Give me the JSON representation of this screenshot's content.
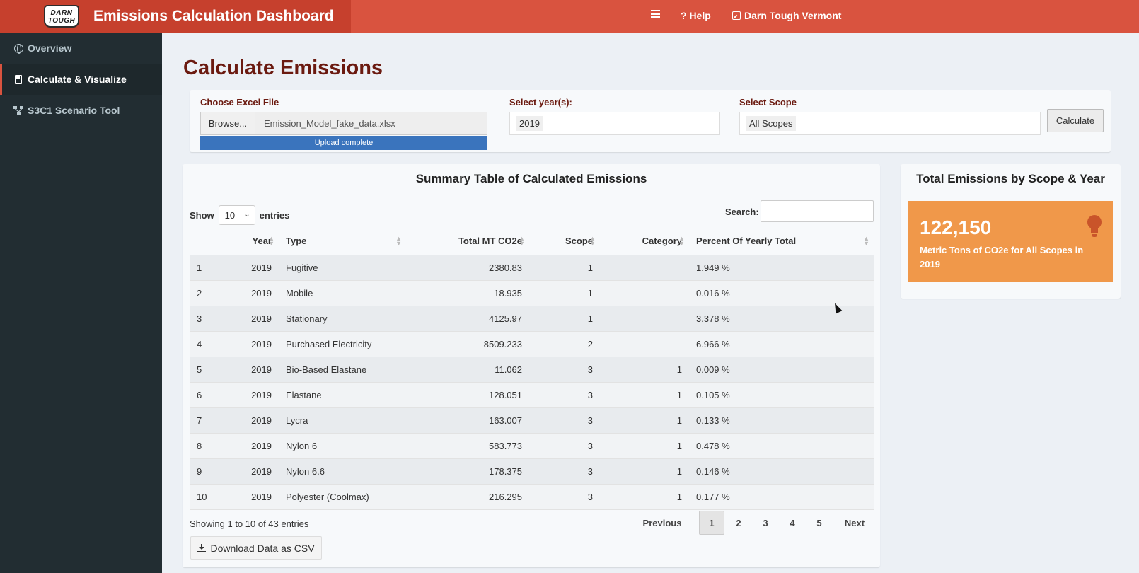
{
  "header": {
    "logo_line1": "DARN",
    "logo_line2": "TOUGH",
    "title": "Emissions Calculation Dashboard",
    "help_label": "? Help",
    "user_label": "Darn Tough Vermont",
    "color": "#d9533f"
  },
  "sidebar": {
    "items": [
      {
        "label": "Overview",
        "icon": "globe-icon"
      },
      {
        "label": "Calculate & Visualize",
        "icon": "calculator-icon",
        "active": true
      },
      {
        "label": "S3C1 Scenario Tool",
        "icon": "sitemap-icon"
      }
    ]
  },
  "main": {
    "page_title": "Calculate Emissions",
    "file": {
      "label": "Choose Excel File",
      "browse_label": "Browse...",
      "file_name": "Emission_Model_fake_data.xlsx",
      "progress_text": "Upload complete",
      "progress": 1.0
    },
    "year": {
      "label": "Select year(s):",
      "value": "2019"
    },
    "scope": {
      "label": "Select Scope",
      "value": "All Scopes"
    },
    "calculate_label": "Calculate"
  },
  "summary": {
    "title": "Summary Table of Calculated Emissions",
    "show_label": "Show",
    "entries_label": "entries",
    "length_value": "10",
    "search_label": "Search:",
    "columns": [
      "",
      "Year",
      "Type",
      "Total MT CO2e",
      "Scope",
      "Category",
      "Percent Of Yearly Total"
    ],
    "rows": [
      [
        "1",
        "2019",
        "Fugitive",
        "2380.83",
        "1",
        "",
        "1.949 %"
      ],
      [
        "2",
        "2019",
        "Mobile",
        "18.935",
        "1",
        "",
        "0.016 %"
      ],
      [
        "3",
        "2019",
        "Stationary",
        "4125.97",
        "1",
        "",
        "3.378 %"
      ],
      [
        "4",
        "2019",
        "Purchased Electricity",
        "8509.233",
        "2",
        "",
        "6.966 %"
      ],
      [
        "5",
        "2019",
        "Bio-Based Elastane",
        "11.062",
        "3",
        "1",
        "0.009 %"
      ],
      [
        "6",
        "2019",
        "Elastane",
        "128.051",
        "3",
        "1",
        "0.105 %"
      ],
      [
        "7",
        "2019",
        "Lycra",
        "163.007",
        "3",
        "1",
        "0.133 %"
      ],
      [
        "8",
        "2019",
        "Nylon 6",
        "583.773",
        "3",
        "1",
        "0.478 %"
      ],
      [
        "9",
        "2019",
        "Nylon 6.6",
        "178.375",
        "3",
        "1",
        "0.146 %"
      ],
      [
        "10",
        "2019",
        "Polyester (Coolmax)",
        "216.295",
        "3",
        "1",
        "0.177 %"
      ]
    ],
    "info": "Showing 1 to 10 of 43 entries",
    "pagination": {
      "previous": "Previous",
      "pages": [
        "1",
        "2",
        "3",
        "4",
        "5"
      ],
      "current": "1",
      "next": "Next"
    },
    "download_label": "Download Data as CSV"
  },
  "totals": {
    "title": "Total Emissions by Scope & Year",
    "value": "122,150",
    "caption": "Metric Tons of CO2e for All Scopes in 2019",
    "icon": "lightbulb-icon",
    "color": "#f0984a"
  }
}
